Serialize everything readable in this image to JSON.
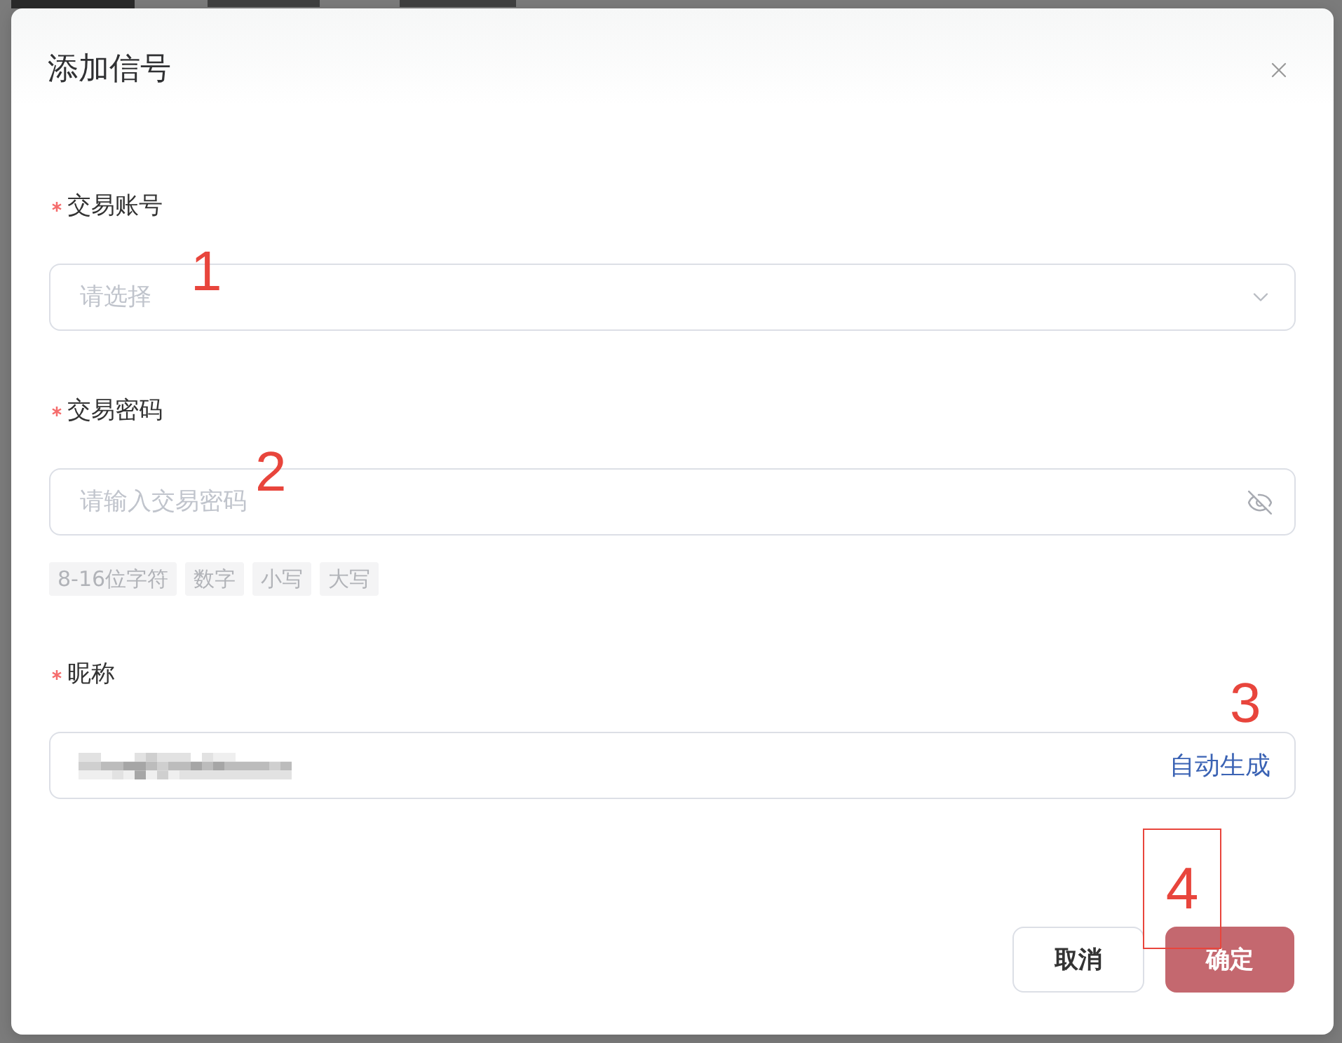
{
  "dialog": {
    "title": "添加信号",
    "closable": true
  },
  "fields": [
    {
      "kind": "select",
      "label": "交易账号",
      "required": true,
      "placeholder": "请选择"
    },
    {
      "kind": "password",
      "label": "交易密码",
      "required": true,
      "placeholder": "请输入交易密码",
      "password_visible": false,
      "hints": [
        "8-16位字符",
        "数字",
        "小写",
        "大写"
      ]
    },
    {
      "kind": "text",
      "label": "昵称",
      "required": true,
      "value_redacted": true,
      "action": "自动生成"
    }
  ],
  "buttons": [
    {
      "label": "取消",
      "kind": "default"
    },
    {
      "label": "确定",
      "kind": "primary"
    }
  ],
  "annotations": [
    {
      "number": "1",
      "framed": false
    },
    {
      "number": "2",
      "framed": false
    },
    {
      "number": "3",
      "framed": false
    },
    {
      "number": "4",
      "framed": true
    }
  ]
}
